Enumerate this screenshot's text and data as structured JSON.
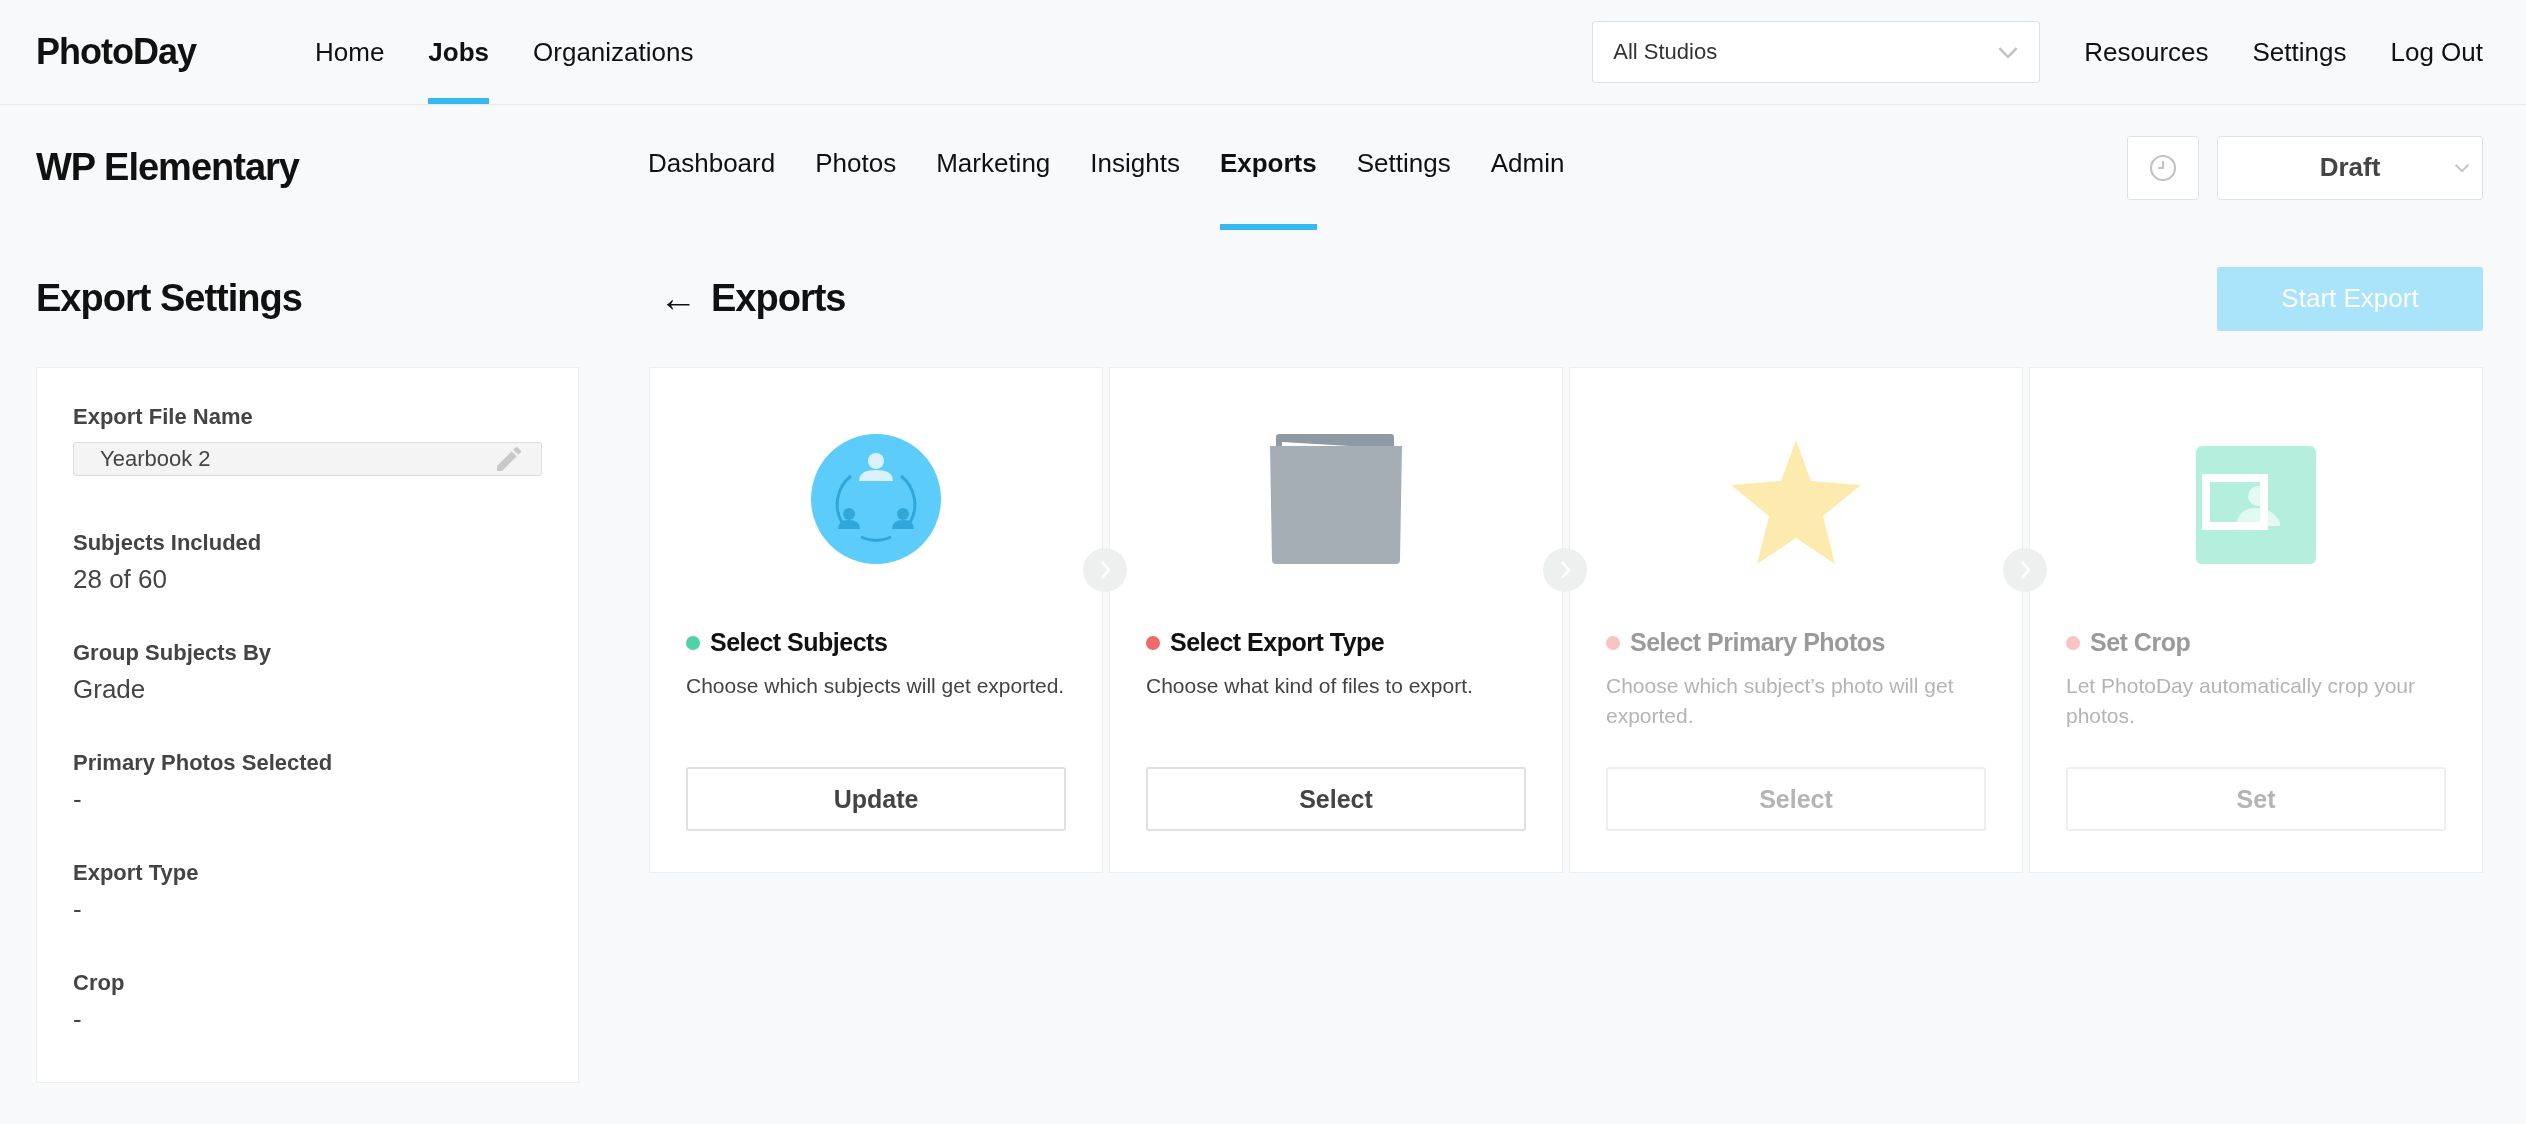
{
  "logo": {
    "text": "PhotoDay"
  },
  "top_nav": [
    {
      "label": "Home",
      "selected": false
    },
    {
      "label": "Jobs",
      "selected": true
    },
    {
      "label": "Organizations",
      "selected": false
    }
  ],
  "studio_select": {
    "value": "All Studios"
  },
  "top_links": [
    "Resources",
    "Settings",
    "Log Out"
  ],
  "job": {
    "title": "WP Elementary"
  },
  "job_tabs": [
    {
      "label": "Dashboard",
      "selected": false
    },
    {
      "label": "Photos",
      "selected": false
    },
    {
      "label": "Marketing",
      "selected": false
    },
    {
      "label": "Insights",
      "selected": false
    },
    {
      "label": "Exports",
      "selected": true
    },
    {
      "label": "Settings",
      "selected": false
    },
    {
      "label": "Admin",
      "selected": false
    }
  ],
  "status_select": {
    "value": "Draft"
  },
  "sidebar": {
    "title": "Export Settings",
    "file_name": {
      "label": "Export File Name",
      "value": "Yearbook 2"
    },
    "fields": [
      {
        "label": "Subjects Included",
        "value": "28 of 60"
      },
      {
        "label": "Group Subjects By",
        "value": "Grade"
      },
      {
        "label": "Primary Photos Selected",
        "value": "-"
      },
      {
        "label": "Export Type",
        "value": "-"
      },
      {
        "label": "Crop",
        "value": "-"
      }
    ]
  },
  "main": {
    "back_arrow": "←",
    "title": "Exports",
    "start_button": {
      "label": "Start Export",
      "disabled": true
    }
  },
  "steps": [
    {
      "kind": "people",
      "title": "Select Subjects",
      "color": "#4fd1a6",
      "disabled": false,
      "description": "Choose which subjects will get exported.",
      "button": "Update"
    },
    {
      "kind": "folder",
      "title": "Select Export Type",
      "color": "#ee6a6a",
      "disabled": false,
      "description": "Choose what kind of files to export.",
      "button": "Select"
    },
    {
      "kind": "star",
      "title": "Select Primary Photos",
      "color": "#f8c3c3",
      "disabled": true,
      "description": "Choose which subject’s photo will get exported.",
      "button": "Select"
    },
    {
      "kind": "crop",
      "title": "Set Crop",
      "color": "#f8c3c3",
      "disabled": true,
      "description": "Let PhotoDay automatically crop your photos.",
      "button": "Set"
    }
  ]
}
